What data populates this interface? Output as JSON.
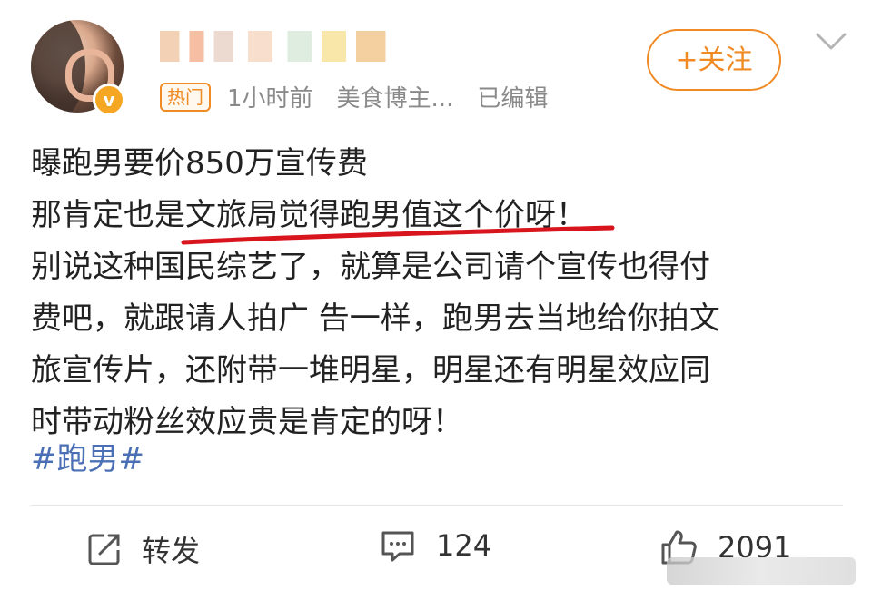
{
  "header": {
    "hot_label": "热门",
    "time": "1小时前",
    "source": "美食博主...",
    "edited": "已编辑",
    "follow_label": "+关注"
  },
  "post": {
    "lines": [
      "曝跑男要价850万宣传费",
      "别说这种国民综艺了，就算是公司请个宣传也得付",
      "费吧，就跟请人拍广 告一样，跑男去当地给你拍文",
      "旅宣传片，还附带一堆明星，明星还有明星效应同",
      "时带动粉丝效应贵是肯定的呀！"
    ],
    "line2_prefix": "那肯定也是",
    "line2_highlight": "文旅局觉得跑男值这个价呀",
    "line2_suffix": "！",
    "hashtag": "#跑男#"
  },
  "actions": {
    "repost_label": "转发",
    "comment_count": "124",
    "like_count": "2091"
  },
  "colors": {
    "accent": "#f08a24",
    "link": "#4a6fb5",
    "highlight_stroke": "#d8141c"
  }
}
